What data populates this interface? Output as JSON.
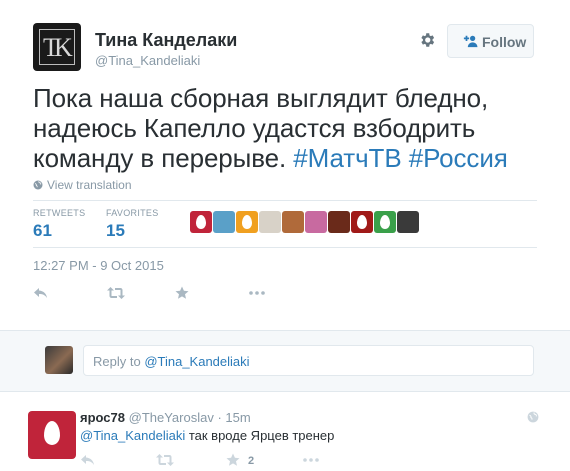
{
  "tweet": {
    "fullname": "Тина Канделаки",
    "username": "@Tina_Kandeliaki",
    "avatar_letters": {
      "left": "T",
      "right": "K"
    },
    "follow_label": "Follow",
    "text_plain": "Пока наша сборная выглядит бледно, надеюсь Капелло удастся взбодрить команду в перерыве. ",
    "hashtag_1": "#МатчТВ",
    "hashtag_2": "#Россия",
    "view_translation": "View translation",
    "stats": {
      "retweets_label": "RETWEETS",
      "retweets_value": "61",
      "favorites_label": "FAVORITES",
      "favorites_value": "15"
    },
    "timestamp": "12:27 PM - 9 Oct 2015"
  },
  "faces": [
    {
      "kind": "egg",
      "color": "#c0243a"
    },
    {
      "kind": "photo",
      "color": "#5aa0c8"
    },
    {
      "kind": "egg",
      "color": "#f0a020"
    },
    {
      "kind": "photo",
      "color": "#d8d2c8"
    },
    {
      "kind": "photo",
      "color": "#b06a3a"
    },
    {
      "kind": "photo",
      "color": "#c86aa0"
    },
    {
      "kind": "photo",
      "color": "#6a2a1a"
    },
    {
      "kind": "egg",
      "color": "#a01a18"
    },
    {
      "kind": "egg",
      "color": "#3aa04a"
    },
    {
      "kind": "photo",
      "color": "#3a3a3a"
    }
  ],
  "reply_box": {
    "prefix": "Reply to ",
    "mention": "@Tina_Kandeliaki"
  },
  "reply": {
    "name": "ярос78",
    "handle": "@TheYaroslav · 15m",
    "mention": "@Tina_Kandeliaki",
    "text": " так вроде Ярцев тренер",
    "favorite_count": "2"
  },
  "colors": {
    "link": "#2b7bb9",
    "muted": "#8899a6",
    "text": "#292f33"
  },
  "icons": [
    "gear-icon",
    "follow-user-icon",
    "globe-icon",
    "reply-icon",
    "retweet-icon",
    "favorite-icon",
    "more-icon"
  ]
}
